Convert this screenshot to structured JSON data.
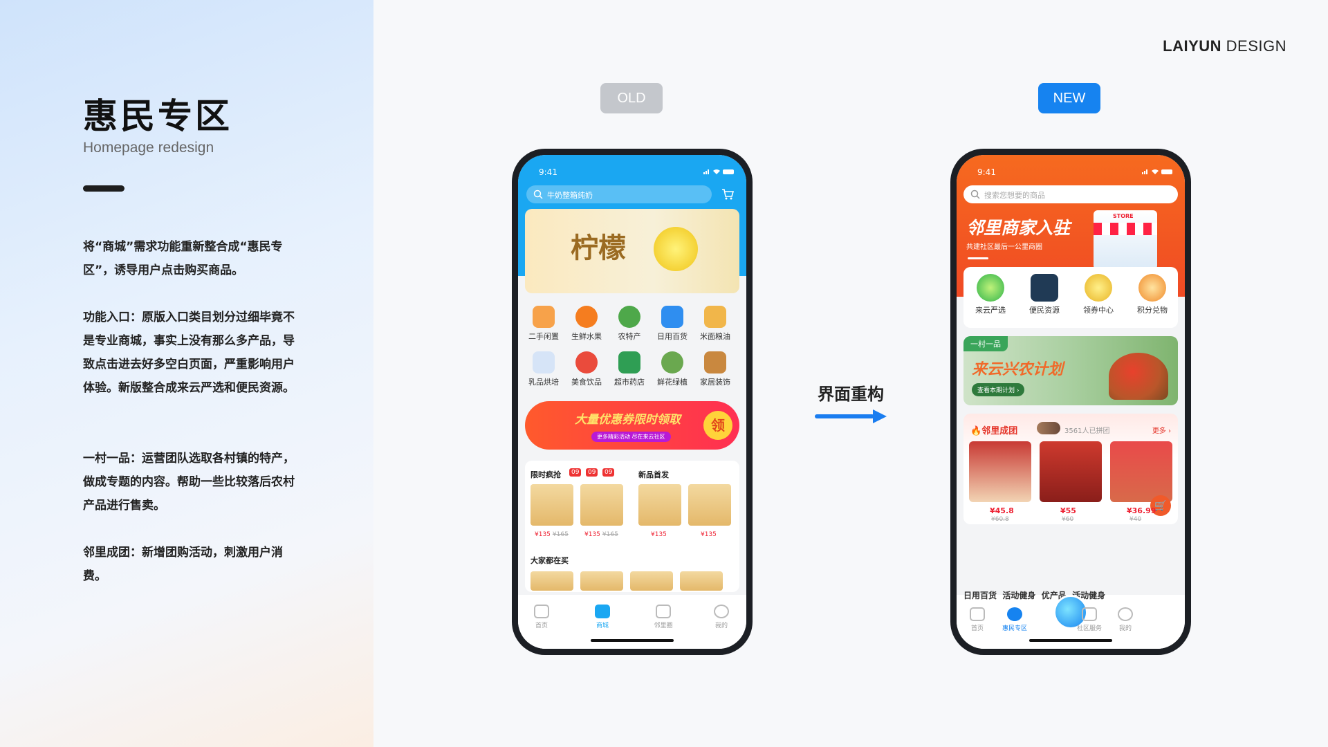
{
  "brand": {
    "bold": "LAIYUN",
    "light": " DESIGN"
  },
  "title": "惠民专区",
  "subtitle": "Homepage redesign",
  "paragraphs": [
    "将“商城”需求功能重新整合成“惠民专区”，诱导用户点击购买商品。",
    "功能入口：原版入口类目划分过细毕竟不是专业商城，事实上没有那么多产品，导致点击进去好多空白页面，严重影响用户体验。新版整合成来云严选和便民资源。",
    "一村一品：运营团队选取各村镇的特产，做成专题的内容。帮助一些比较落后农村产品进行售卖。",
    "邻里成团：新增团购活动，刺激用户消费。"
  ],
  "old_tag": "OLD",
  "new_tag": "NEW",
  "arrow_label": "界面重构",
  "colors": {
    "old_tag": "#c4c7cc",
    "new_tag": "#1683f0",
    "old_theme": "#1aa7f2",
    "new_theme": "#f4561e",
    "arrow": "#1a7df0"
  },
  "old_phone": {
    "time": "9:41",
    "search_placeholder": "牛奶整箱纯奶",
    "banner_text": "柠檬",
    "categories": [
      "二手闲置",
      "生鲜水果",
      "农特产",
      "日用百货",
      "米面粮油",
      "乳品烘培",
      "美食饮品",
      "超市药店",
      "鲜花绿植",
      "家居装饰"
    ],
    "promo_text": "大量优惠券限时领取",
    "promo_sub": "更多精彩活动 尽在来云社区",
    "promo_btn": "领",
    "flash_title": "限时疯抢",
    "countdown": [
      "09",
      "09",
      "09"
    ],
    "new_title": "新品首发",
    "prices": [
      {
        "now": "¥135",
        "old": "¥165"
      },
      {
        "now": "¥135",
        "old": "¥165"
      },
      {
        "now": "¥135",
        "old": ""
      },
      {
        "now": "¥135",
        "old": ""
      }
    ],
    "popular_title": "大家都在买",
    "tabs": [
      "首页",
      "商城",
      "邻里圈",
      "我的"
    ]
  },
  "new_phone": {
    "time": "9:41",
    "search_placeholder": "搜索您想要的商品",
    "banner_title": "邻里商家入驻",
    "banner_sub": "共建社区最后一公里商圈",
    "store_sign": "STORE",
    "categories": [
      "来云严选",
      "便民资源",
      "领券中心",
      "积分兑物"
    ],
    "village_tag": "一村一品",
    "village_title": "来云兴农计划",
    "village_btn": "查看本期计划 ›",
    "group_title": "邻里成团",
    "group_count": "3561人已拼团",
    "group_more": "更多 ›",
    "group_prices": [
      {
        "now": "¥45.8",
        "old": "¥60.8"
      },
      {
        "now": "¥55",
        "old": "¥60"
      },
      {
        "now": "¥36.99",
        "old": "¥40"
      }
    ],
    "bottom_cats": [
      "日用百货",
      "活动健身",
      "优产品",
      "活动健身"
    ],
    "tabs": [
      "首页",
      "惠民专区",
      "",
      "社区服务",
      "我的"
    ]
  }
}
